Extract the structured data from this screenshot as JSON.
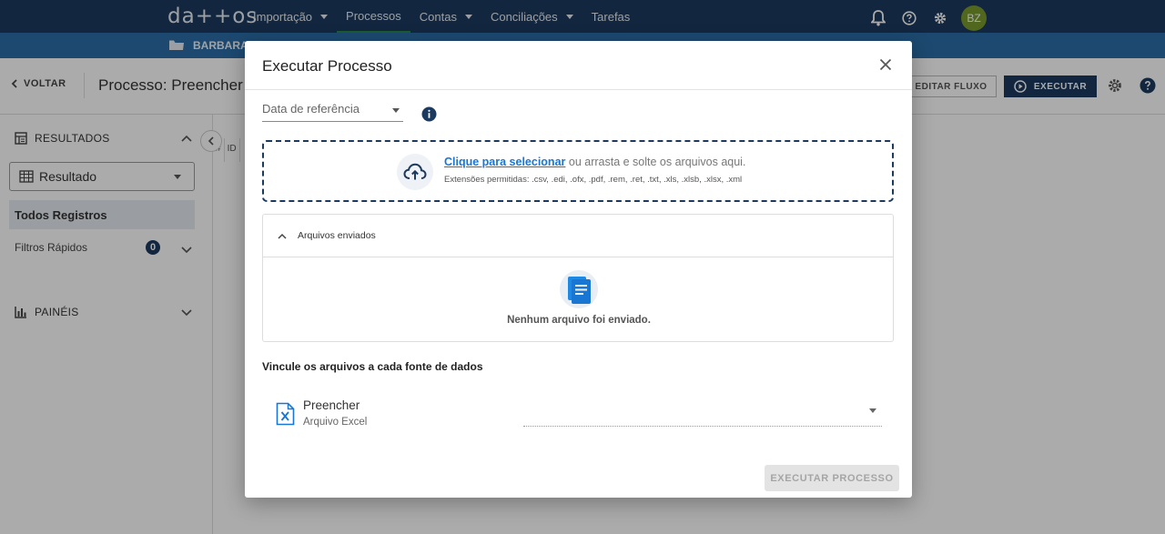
{
  "app": {
    "logo": "da++os"
  },
  "nav": {
    "items": [
      {
        "label": "Importação",
        "has_dropdown": true,
        "active": false
      },
      {
        "label": "Processos",
        "has_dropdown": false,
        "active": true
      },
      {
        "label": "Contas",
        "has_dropdown": true,
        "active": false
      },
      {
        "label": "Conciliações",
        "has_dropdown": true,
        "active": false
      },
      {
        "label": "Tarefas",
        "has_dropdown": false,
        "active": false
      }
    ],
    "icons": [
      "bell-icon",
      "help-icon",
      "gear-icon"
    ],
    "avatar": "BZ"
  },
  "subbar": {
    "label": "BARBARA"
  },
  "toolbar": {
    "back_label": "VOLTAR",
    "title": "Processo: Preencher",
    "edit_label": "EDITAR FLUXO",
    "execute_label": "EXECUTAR"
  },
  "sidebar": {
    "results_label": "RESULTADOS",
    "result_select": "Resultado",
    "all_records": "Todos Registros",
    "quick_filters": "Filtros Rápidos",
    "quick_filters_count": "0",
    "panels_label": "PAINÉIS"
  },
  "grid": {
    "columns": [
      "#",
      "ID"
    ]
  },
  "modal": {
    "title": "Executar Processo",
    "date_field": "Data de referência",
    "dropzone": {
      "link": "Clique para selecionar",
      "text": " ou arrasta e solte os arquivos aqui.",
      "extensions": "Extensões permitidas: .csv, .edi, .ofx, .pdf, .rem, .ret, .txt, .xls, .xlsb, .xlsx, .xml"
    },
    "files_section": "Arquivos enviados",
    "empty_files": "Nenhum arquivo foi enviado.",
    "link_title": "Vincule os arquivos a cada fonte de dados",
    "source": {
      "name": "Preencher",
      "type": "Arquivo Excel"
    },
    "execute_button": "EXECUTAR PROCESSO"
  },
  "colors": {
    "nav_bg": "#1c3a5e",
    "subbar_bg": "#2c6ea8",
    "accent_link": "#1976d2",
    "avatar_bg": "#7a9a2c"
  }
}
